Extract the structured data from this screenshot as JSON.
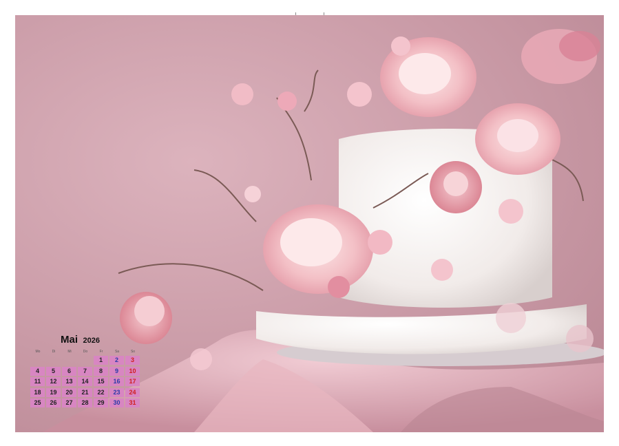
{
  "calendar": {
    "month": "Mai",
    "year": "2026",
    "weekdays": [
      "Mo",
      "Di",
      "Mi",
      "Do",
      "Fr",
      "Sa",
      "So"
    ],
    "weeks": [
      [
        "",
        "",
        "",
        "",
        "1",
        "2",
        "3"
      ],
      [
        "4",
        "5",
        "6",
        "7",
        "8",
        "9",
        "10"
      ],
      [
        "11",
        "12",
        "13",
        "14",
        "15",
        "16",
        "17"
      ],
      [
        "18",
        "19",
        "20",
        "21",
        "22",
        "23",
        "24"
      ],
      [
        "25",
        "26",
        "27",
        "28",
        "29",
        "30",
        "31"
      ]
    ]
  },
  "colors": {
    "day_cell": "#d886c2",
    "saturday_text": "#2a3aa8",
    "sunday_text": "#d01e1e",
    "background_pink": "#c99aa6"
  }
}
